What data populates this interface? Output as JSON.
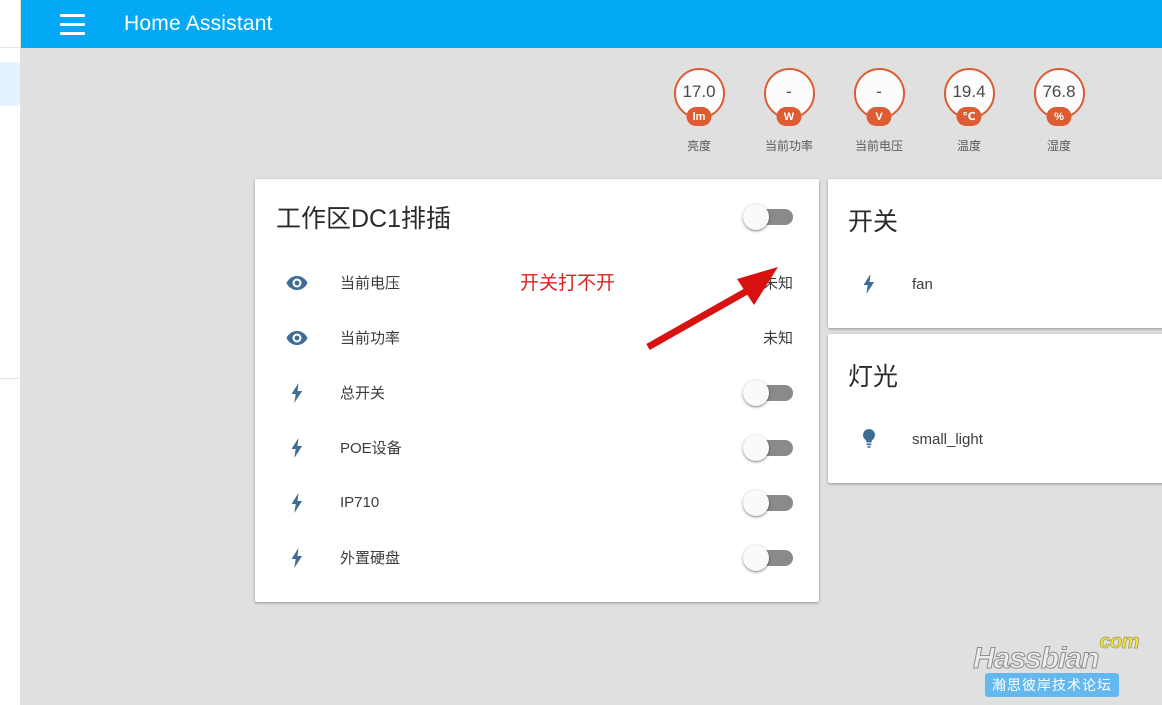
{
  "app": {
    "title": "Home Assistant",
    "menu_icon": "hamburger-menu-icon",
    "accent_color": "#03a9f4",
    "background_color": "#e0e0e0"
  },
  "badges": [
    {
      "value": "17.0",
      "unit": "lm",
      "label": "亮度",
      "color": "#dd5c31"
    },
    {
      "value": "-",
      "unit": "W",
      "label": "当前功率",
      "color": "#dd5c31"
    },
    {
      "value": "-",
      "unit": "V",
      "label": "当前电压",
      "color": "#dd5c31"
    },
    {
      "value": "19.4",
      "unit": "℃",
      "label": "温度",
      "color": "#dd5c31"
    },
    {
      "value": "76.8",
      "unit": "%",
      "label": "湿度",
      "color": "#dd5c31"
    }
  ],
  "main_card": {
    "title": "工作区DC1排插",
    "header_toggle": {
      "state": "off"
    },
    "rows": [
      {
        "name": "当前电压",
        "icon": "eye-icon",
        "control": "state",
        "state": "未知"
      },
      {
        "name": "当前功率",
        "icon": "eye-icon",
        "control": "state",
        "state": "未知"
      },
      {
        "name": "总开关",
        "icon": "lightning-icon",
        "control": "toggle",
        "state": "off"
      },
      {
        "name": "POE设备",
        "icon": "lightning-icon",
        "control": "toggle",
        "state": "off"
      },
      {
        "name": "IP710",
        "icon": "lightning-icon",
        "control": "toggle",
        "state": "off"
      },
      {
        "name": "外置硬盘",
        "icon": "lightning-icon",
        "control": "toggle",
        "state": "off"
      }
    ]
  },
  "switch_card": {
    "title": "开关",
    "rows": [
      {
        "name": "fan",
        "icon": "lightning-icon"
      }
    ]
  },
  "light_card": {
    "title": "灯光",
    "rows": [
      {
        "name": "small_light",
        "icon": "lightbulb-icon"
      }
    ]
  },
  "annotation": {
    "text": "开关打不开",
    "color": "#e02020",
    "arrow": "red-arrow-pointing-to-header-toggle"
  },
  "watermark": {
    "main": "Hassbian",
    "tld": "com",
    "subtitle": "瀚思彼岸技术论坛"
  }
}
